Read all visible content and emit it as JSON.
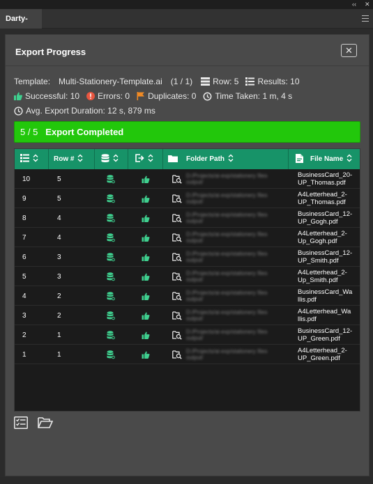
{
  "window": {
    "collapse_glyph": "‹‹",
    "close_glyph": "✕"
  },
  "panel_tab": {
    "label": "Darty-Ai."
  },
  "dialog": {
    "title": "Export Progress",
    "close_glyph": "✕",
    "template_label": "Template:",
    "template_name": "Multi-Stationery-Template.ai",
    "template_count": "(1 / 1)",
    "row_label": "Row: 5",
    "results_label": "Results: 10",
    "successful_label": "Successful: 10",
    "errors_label": "Errors: 0",
    "duplicates_label": "Duplicates: 0",
    "time_taken_label": "Time Taken: 1 m, 4 s",
    "avg_duration_label": "Avg. Export Duration: 12 s, 879 ms",
    "progress": {
      "count": "5 / 5",
      "status": "Export Completed",
      "fraction": 1.0
    }
  },
  "table": {
    "headers": {
      "row_num": "Row #",
      "folder_path": "Folder Path",
      "file_name": "File Name"
    },
    "rows": [
      {
        "idx": "10",
        "row": "5",
        "path": "D:/Projects/ai-exp/stationery files output/",
        "file": "BusinessCard_20-\nUP_Thomas.pdf"
      },
      {
        "idx": "9",
        "row": "5",
        "path": "D:/Projects/ai-exp/stationery files output/",
        "file": "A4Letterhead_2-\nUP_Thomas.pdf"
      },
      {
        "idx": "8",
        "row": "4",
        "path": "D:/Projects/ai-exp/stationery files output/",
        "file": "BusinessCard_12-\nUP_Gogh.pdf"
      },
      {
        "idx": "7",
        "row": "4",
        "path": "D:/Projects/ai-exp/stationery files output/",
        "file": "A4Letterhead_2-\nUp_Gogh.pdf"
      },
      {
        "idx": "6",
        "row": "3",
        "path": "D:/Projects/ai-exp/stationery files output/",
        "file": "BusinessCard_12-\nUP_Smith.pdf"
      },
      {
        "idx": "5",
        "row": "3",
        "path": "D:/Projects/ai-exp/stationery files output/",
        "file": "A4Letterhead_2-\nUp_Smith.pdf"
      },
      {
        "idx": "4",
        "row": "2",
        "path": "D:/Projects/ai-exp/stationery files output/",
        "file": "BusinessCard_Wa\nllis.pdf"
      },
      {
        "idx": "3",
        "row": "2",
        "path": "D:/Projects/ai-exp/stationery files output/",
        "file": "A4Letterhead_Wa\nllis.pdf"
      },
      {
        "idx": "2",
        "row": "1",
        "path": "D:/Projects/ai-exp/stationery files output/",
        "file": "BusinessCard_12-\nUP_Green.pdf"
      },
      {
        "idx": "1",
        "row": "1",
        "path": "D:/Projects/ai-exp/stationery files output/",
        "file": "A4Letterhead_2-\nUP_Green.pdf"
      }
    ]
  },
  "colors": {
    "header_green": "#179368",
    "progress_green": "#22c70b",
    "icon_green": "#3fd08f",
    "error_red": "#e8553f",
    "flag_orange": "#f08a24"
  }
}
